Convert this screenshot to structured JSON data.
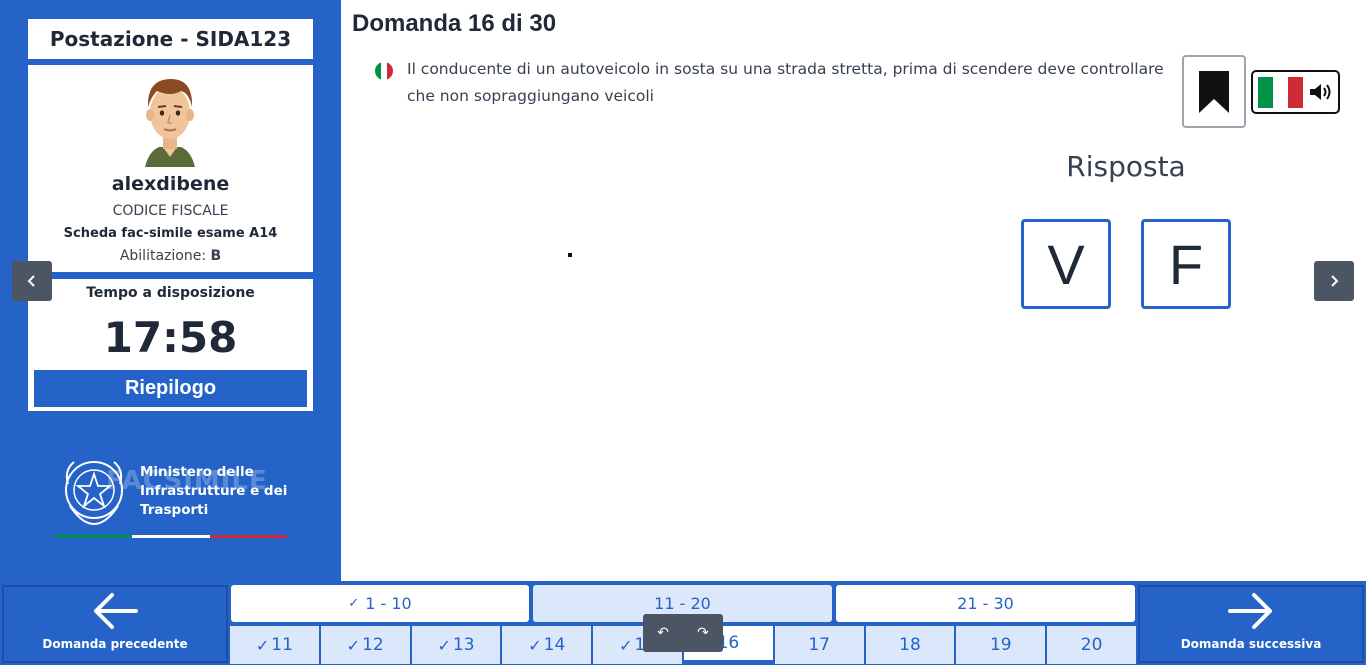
{
  "sidebar": {
    "station": "Postazione - SIDA123",
    "username": "alexdibene",
    "codice_fiscale": "CODICE FISCALE",
    "scheda": "Scheda fac-simile esame A14",
    "abilitazione_label": "Abilitazione:",
    "abilitazione_value": "B",
    "timer_label": "Tempo a disposizione",
    "timer_value": "17:58",
    "riepilogo": "Riepilogo",
    "ministry": {
      "line1": "Ministero delle",
      "line2": "Infrastrutture e dei",
      "line3": "Trasporti",
      "watermark": "FACSIMILE"
    }
  },
  "question": {
    "title": "Domanda 16 di 30",
    "text": "Il conducente di un autoveicolo in sosta su una strada stretta, prima di scendere deve controllare che non sopraggiungano veicoli",
    "answer_label": "Risposta",
    "answer_true": "V",
    "answer_false": "F"
  },
  "bottom": {
    "prev_label": "Domanda precedente",
    "next_label": "Domanda successiva",
    "groups": [
      {
        "label": "1 - 10",
        "done": true
      },
      {
        "label": "11 - 20",
        "done": false
      },
      {
        "label": "21 - 30",
        "done": false
      }
    ],
    "numbers": [
      {
        "label": "11",
        "answered": true
      },
      {
        "label": "12",
        "answered": true
      },
      {
        "label": "13",
        "answered": true
      },
      {
        "label": "14",
        "answered": true
      },
      {
        "label": "15",
        "answered": true
      },
      {
        "label": "16",
        "answered": false,
        "current": true
      },
      {
        "label": "17",
        "answered": false
      },
      {
        "label": "18",
        "answered": false
      },
      {
        "label": "19",
        "answered": false
      },
      {
        "label": "20",
        "answered": false
      }
    ]
  },
  "colors": {
    "primary": "#2563c8",
    "light": "#dbe7fb",
    "italy_green": "#009246",
    "italy_red": "#ce2b37"
  },
  "icons": {
    "bookmark": "bookmark-icon",
    "audio": "speaker-icon",
    "prev": "arrow-left-icon",
    "next": "arrow-right-icon"
  }
}
